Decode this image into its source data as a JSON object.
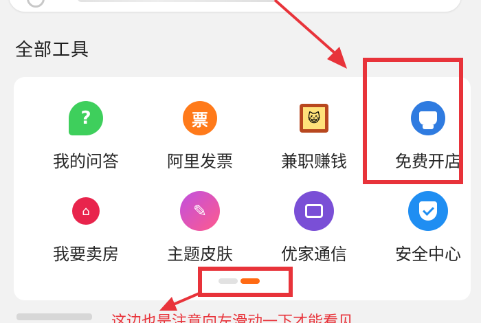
{
  "search": {
    "placeholder": ""
  },
  "section": {
    "title": "全部工具"
  },
  "tools": [
    {
      "label": "我的问答",
      "icon": "question-bubble-icon",
      "glyph": "?"
    },
    {
      "label": "阿里发票",
      "icon": "invoice-icon",
      "glyph": "票"
    },
    {
      "label": "兼职赚钱",
      "icon": "part-time-icon",
      "glyph": "😺"
    },
    {
      "label": "免费开店",
      "icon": "shop-icon"
    },
    {
      "label": "我要卖房",
      "icon": "house-icon",
      "glyph": "⌂"
    },
    {
      "label": "主题皮肤",
      "icon": "theme-palette-icon",
      "glyph": "✎"
    },
    {
      "label": "优家通信",
      "icon": "family-communication-icon"
    },
    {
      "label": "安全中心",
      "icon": "security-shield-icon"
    }
  ],
  "pager": {
    "pages": 2,
    "active_page": 2
  },
  "annotation": {
    "text": "这边也是注意向左滑动一下才能看见"
  },
  "colors": {
    "annotation_red": "#e8333a",
    "pager_active": "#ff6a13",
    "background": "#f2f2f2",
    "card": "#ffffff"
  }
}
